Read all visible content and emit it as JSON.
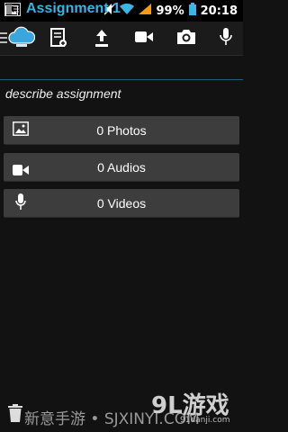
{
  "status_bar": {
    "battery_percent": "99%",
    "time": "20:18",
    "icons": [
      "image-notification-icon",
      "mute-icon",
      "wifi-icon",
      "signal-icon",
      "battery-icon"
    ]
  },
  "action_bar": {
    "icons": [
      "menu-icon",
      "cloud-app-icon",
      "new-document-icon",
      "upload-icon",
      "video-camera-icon",
      "camera-icon",
      "microphone-icon"
    ]
  },
  "assignment": {
    "title": "Assignment 1",
    "description": "describe assignment"
  },
  "media": [
    {
      "label": "0 Photos",
      "icon": "image-icon"
    },
    {
      "label": "0 Audios",
      "icon": "video-camera-icon"
    },
    {
      "label": "0 Videos",
      "icon": "microphone-icon"
    }
  ],
  "watermark": {
    "left": "新意手游 • SJXINYI.COM",
    "logo": "9L游戏",
    "sub": "91danji.com"
  },
  "colors": {
    "accent": "#33b5e5",
    "button": "#3d3d3d",
    "background": "#121212"
  }
}
